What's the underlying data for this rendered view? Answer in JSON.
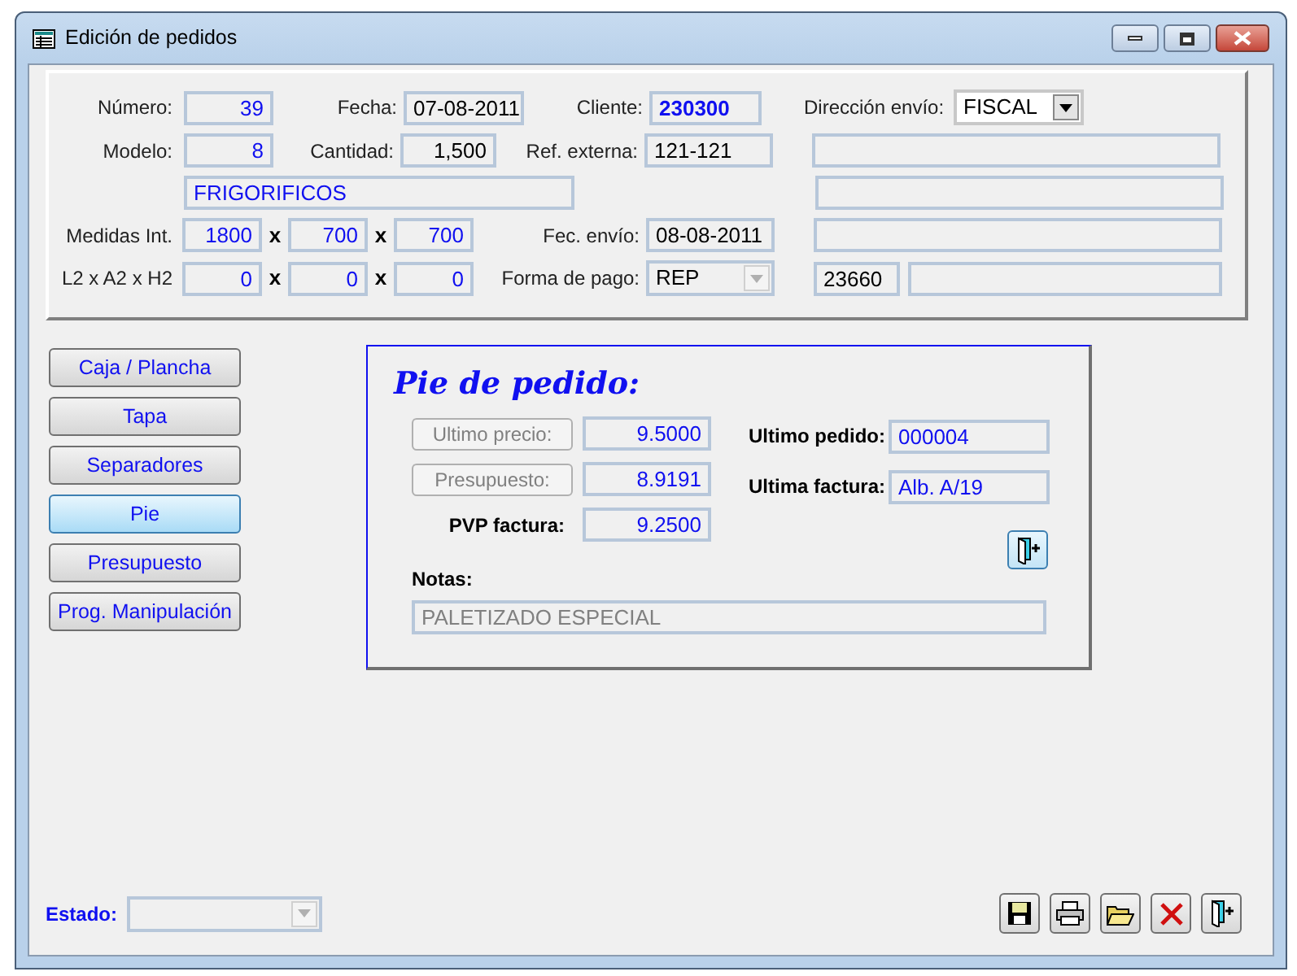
{
  "window": {
    "title": "Edición de pedidos"
  },
  "header": {
    "numero": {
      "label": "Número:",
      "value": "39"
    },
    "fecha": {
      "label": "Fecha:",
      "value": "07-08-2011"
    },
    "cliente": {
      "label": "Cliente:",
      "value": "230300"
    },
    "direccion": {
      "label": "Dirección envío:",
      "value": "FISCAL",
      "disabled": false
    },
    "modelo": {
      "label": "Modelo:",
      "value": "8"
    },
    "cantidad": {
      "label": "Cantidad:",
      "value": "1,500"
    },
    "ref_externa": {
      "label": "Ref. externa:",
      "value": "121-121"
    },
    "descripcion": {
      "value": "FRIGORIFICOS"
    },
    "medidas": {
      "label": "Medidas Int.",
      "values": [
        "1800",
        "700",
        "700"
      ],
      "separators": [
        "x",
        "x"
      ]
    },
    "medidas2": {
      "label": "L2 x A2 x H2",
      "values": [
        "0",
        "0",
        "0"
      ],
      "separators": [
        "x",
        "x"
      ]
    },
    "fec_envio": {
      "label": "Fec. envío:",
      "value": "08-08-2011"
    },
    "forma_pago": {
      "label": "Forma de pago:",
      "value": "REP",
      "disabled": true
    },
    "codigo": {
      "value": "23660"
    }
  },
  "nav": [
    {
      "label": "Caja / Plancha",
      "selected": false
    },
    {
      "label": "Tapa",
      "selected": false
    },
    {
      "label": "Separadores",
      "selected": false
    },
    {
      "label": "Pie",
      "selected": true
    },
    {
      "label": "Presupuesto",
      "selected": false
    },
    {
      "label": "Prog. Manipulación",
      "selected": false
    }
  ],
  "pie": {
    "title": "Pie de pedido:",
    "left_rows": [
      {
        "kind": "button",
        "label": "Ultimo precio:",
        "value": "9.5000",
        "disabled": true
      },
      {
        "kind": "button",
        "label": "Presupuesto:",
        "value": "8.9191",
        "disabled": true
      },
      {
        "kind": "label",
        "label": "PVP factura:",
        "value": "9.2500"
      }
    ],
    "right_rows": [
      {
        "label": "Ultimo pedido:",
        "value": "000004"
      },
      {
        "label": "Ultima factura:",
        "value": "Alb. A/19"
      }
    ],
    "notas": {
      "label": "Notas:",
      "value": "PALETIZADO ESPECIAL"
    }
  },
  "footer": {
    "estado": {
      "label": "Estado:",
      "disabled": true
    }
  }
}
